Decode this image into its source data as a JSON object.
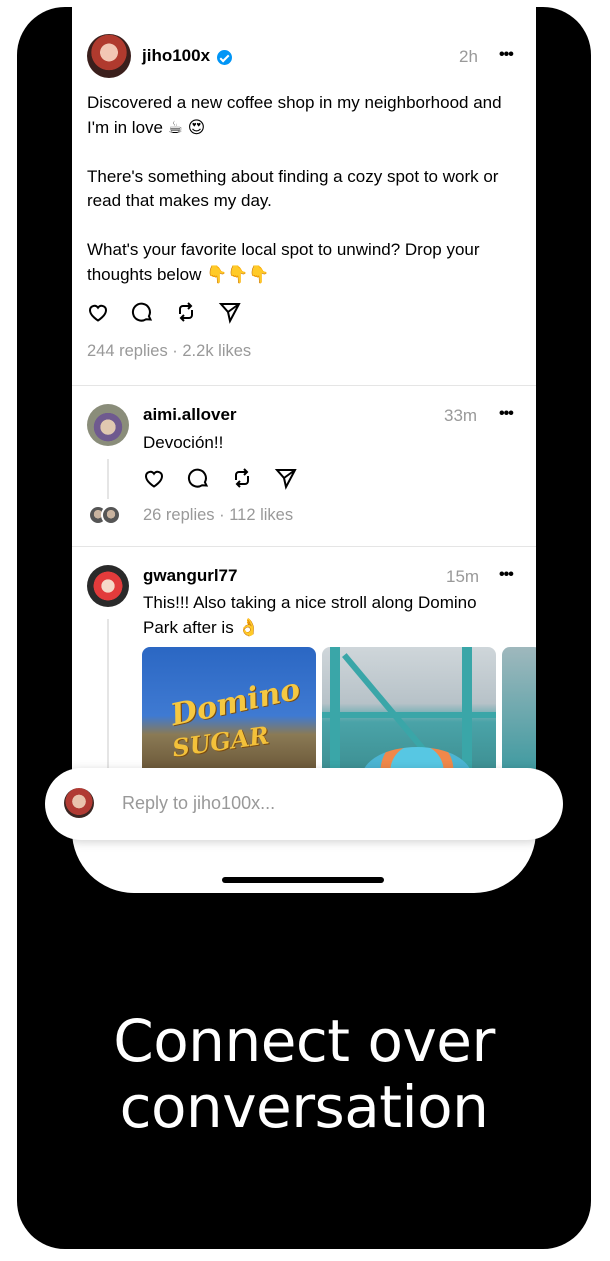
{
  "main_post": {
    "username": "jiho100x",
    "time": "2h",
    "more": "•••",
    "paragraphs": [
      "Discovered a new coffee shop in my neighborhood and I'm in love ☕ 😍",
      "There's something about finding a cozy spot to work or read that makes my day.",
      "What's your favorite local spot to unwind? Drop your thoughts below 👇👇👇"
    ],
    "stats": "244 replies · 2.2k likes"
  },
  "reply1": {
    "username": "aimi.allover",
    "time": "33m",
    "more": "•••",
    "text": "Devoción!!",
    "stats": "26 replies · 112 likes"
  },
  "reply2": {
    "username": "gwangurl77",
    "time": "15m",
    "more": "•••",
    "text": "This!!! Also taking a nice stroll along Domino Park after is 👌",
    "image_sign_line1": "Domino",
    "image_sign_line2": "SUGAR"
  },
  "reply_bar": {
    "placeholder": "Reply to jiho100x..."
  },
  "caption": {
    "line1": "Connect over",
    "line2": "conversation"
  },
  "colors": {
    "verified": "#0095f6",
    "muted_text": "#999999",
    "background_frame": "#000000"
  }
}
